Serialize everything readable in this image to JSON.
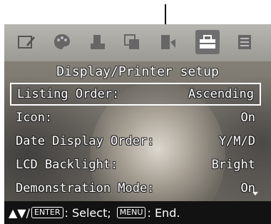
{
  "title": "Display/Printer setup",
  "tabs": [
    {
      "name": "edit-icon"
    },
    {
      "name": "palette-icon"
    },
    {
      "name": "print-icon"
    },
    {
      "name": "copy-icon"
    },
    {
      "name": "tools-icon"
    },
    {
      "name": "toolbox-icon",
      "active": true
    },
    {
      "name": "settings-list-icon"
    }
  ],
  "menu": {
    "items": [
      {
        "label": "Listing Order:",
        "value": "Ascending",
        "selected": true
      },
      {
        "label": "Icon:",
        "value": "On"
      },
      {
        "label": "Date Display Order:",
        "value": "Y/M/D"
      },
      {
        "label": "LCD Backlight:",
        "value": "Bright"
      },
      {
        "label": "Demonstration Mode:",
        "value": "On"
      }
    ]
  },
  "footer": {
    "arrows": "▲▼/",
    "enter_key": "ENTER",
    "select_text": ": Select;",
    "menu_key": "MENU",
    "end_text": ": End."
  }
}
